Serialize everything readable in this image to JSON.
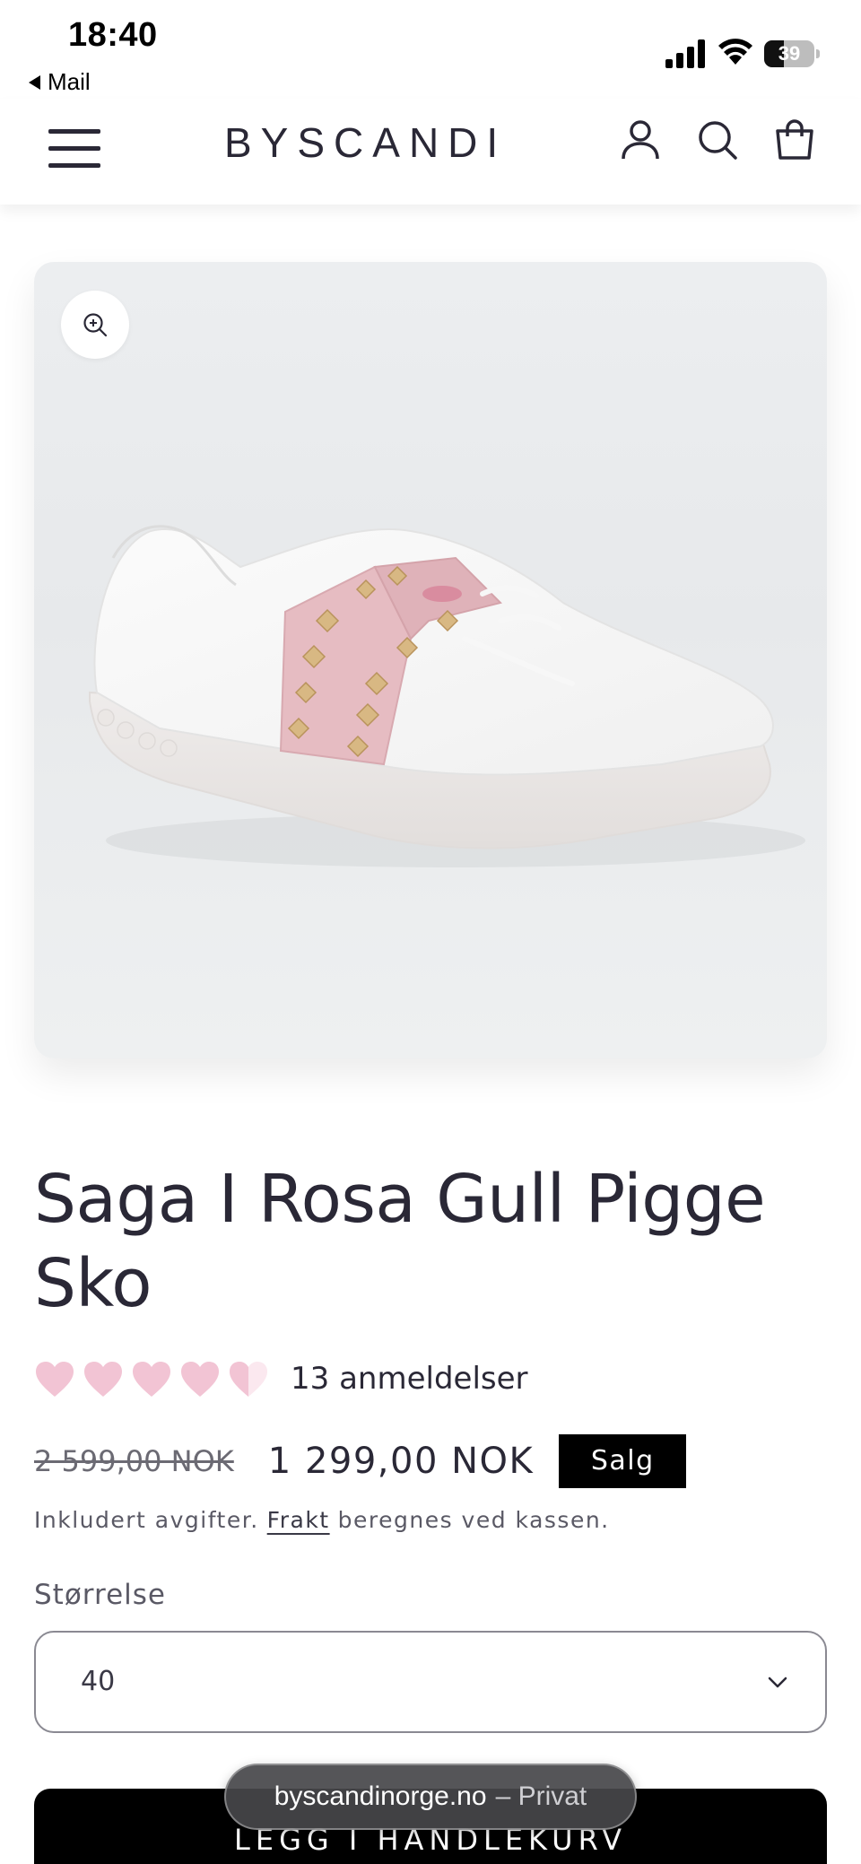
{
  "status_bar": {
    "time": "18:40",
    "back_label": "Mail",
    "battery_level": "39",
    "battery_fraction": 0.39
  },
  "header": {
    "logo": "BYSCANDI",
    "icons": [
      "menu-icon",
      "account-icon",
      "search-icon",
      "cart-icon"
    ]
  },
  "product": {
    "image_alt": "White leather sneaker with pink strap and gold studs",
    "title": "Saga I Rosa Gull Pigge Sko",
    "rating": {
      "value": 4.5,
      "max": 5,
      "reviews_label": "13 anmeldelser"
    },
    "price_original": "2 599,00 NOK",
    "price_sale": "1 299,00 NOK",
    "sale_badge": "Salg",
    "tax_note_prefix": "Inkludert avgifter.",
    "tax_note_link": "Frakt",
    "tax_note_suffix": "beregnes ved kassen.",
    "size_label": "Størrelse",
    "size_selected": "40",
    "add_to_cart": "LEGG I HANDLEKURV"
  },
  "browser": {
    "domain": "byscandinorge.no",
    "mode": "– Privat"
  },
  "colors": {
    "text": "#2a2836",
    "heart": "#f2c4d4",
    "badge_bg": "#000000",
    "cart_bg": "#000000"
  }
}
